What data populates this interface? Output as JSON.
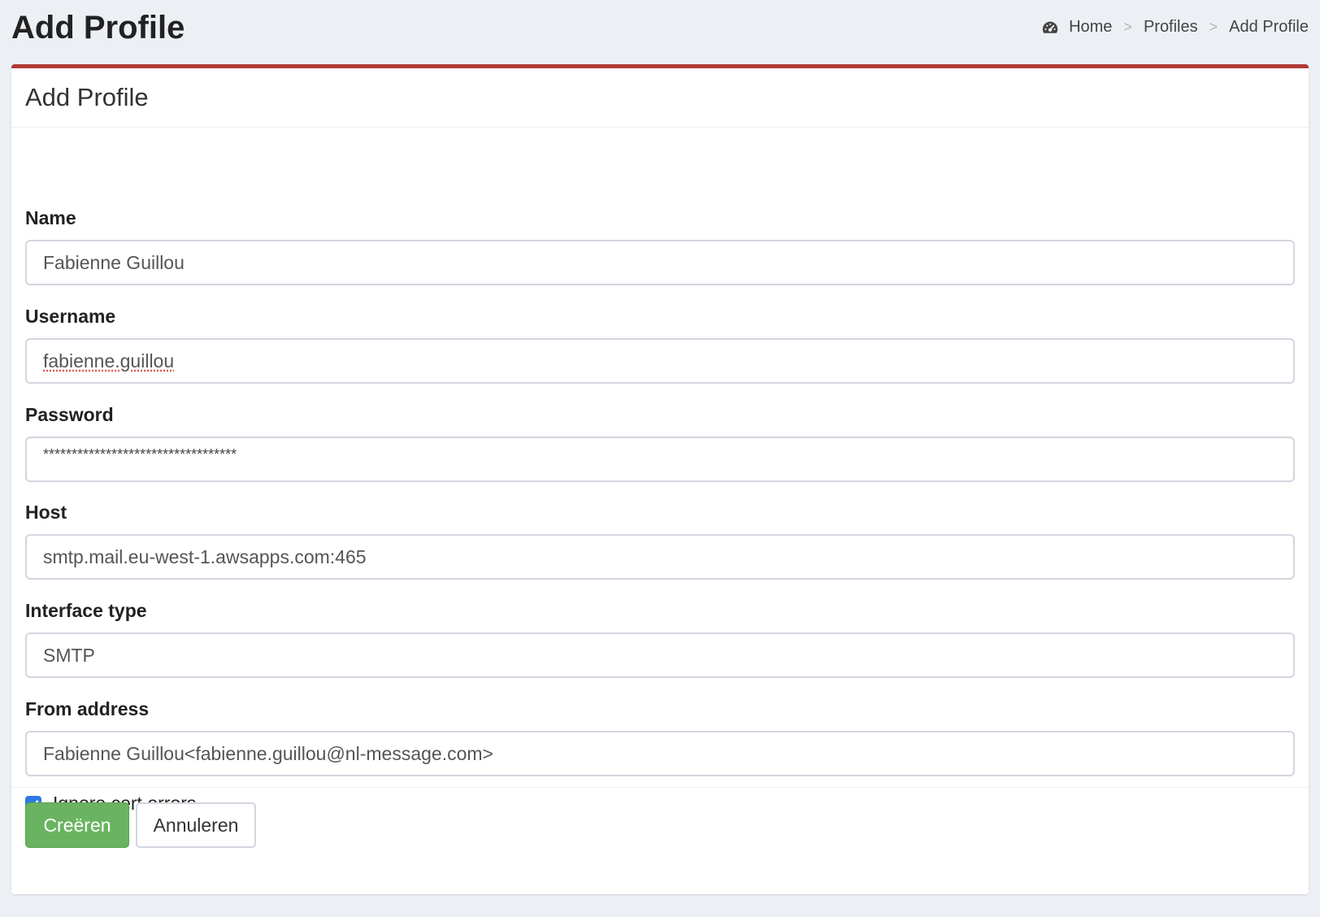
{
  "header": {
    "title": "Add Profile",
    "breadcrumb": [
      {
        "label": "Home",
        "icon": "dashboard-icon"
      },
      {
        "label": "Profiles"
      },
      {
        "label": "Add Profile"
      }
    ],
    "separator": ">"
  },
  "box": {
    "title": "Add Profile",
    "accent_color": "#b03a34"
  },
  "form": {
    "name": {
      "label": "Name",
      "value": "Fabienne Guillou"
    },
    "username": {
      "label": "Username",
      "value": "fabienne.guillou"
    },
    "password": {
      "label": "Password",
      "value": "**********************************"
    },
    "host": {
      "label": "Host",
      "value": "smtp.mail.eu-west-1.awsapps.com:465"
    },
    "interface_type": {
      "label": "Interface type",
      "value": "SMTP"
    },
    "from_address": {
      "label": "From address",
      "value": "Fabienne Guillou<fabienne.guillou@nl-message.com>"
    },
    "ignore_cert": {
      "label": "Ignore cert errors",
      "checked": true
    }
  },
  "footer": {
    "create_label": "Creëren",
    "cancel_label": "Annuleren",
    "create_color": "#6ab461"
  }
}
